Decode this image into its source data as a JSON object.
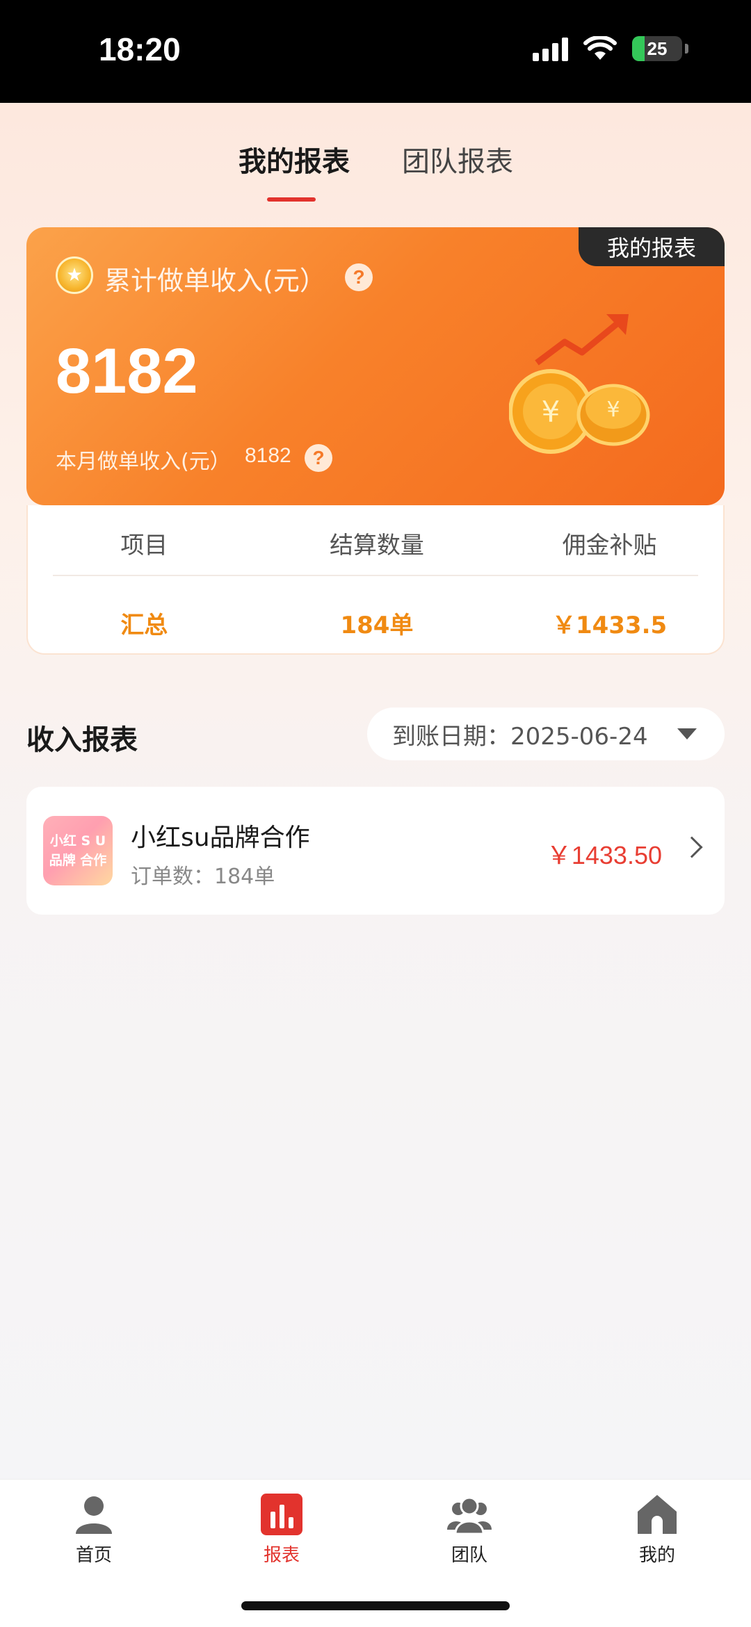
{
  "status_bar": {
    "time": "18:20",
    "battery": "25",
    "battery_level": 0.25
  },
  "tabs": [
    {
      "label": "我的报表",
      "active": true
    },
    {
      "label": "团队报表",
      "active": false
    }
  ],
  "income_card": {
    "corner_tag": "我的报表",
    "title": "累计做单收入(元）",
    "total": "8182",
    "month_label": "本月做单收入(元）",
    "month_value": "8182",
    "help_glyph": "?"
  },
  "summary": {
    "headers": [
      "项目",
      "结算数量",
      "佣金补贴"
    ],
    "row": [
      "汇总",
      "184单",
      "￥1433.5"
    ]
  },
  "income_report": {
    "title": "收入报表",
    "date_label": "到账日期：2025-06-24",
    "items": [
      {
        "logo_line1": "小红 S U",
        "logo_line2": "品牌 合作",
        "name": "小红su品牌合作",
        "orders": "订单数：184单",
        "amount": "￥1433.50"
      }
    ]
  },
  "bottom_nav": [
    {
      "label": "首页",
      "icon": "person-icon",
      "active": false
    },
    {
      "label": "报表",
      "icon": "report-chart-icon",
      "active": true
    },
    {
      "label": "团队",
      "icon": "team-icon",
      "active": false
    },
    {
      "label": "我的",
      "icon": "house-icon",
      "active": false
    }
  ],
  "colors": {
    "accent_red": "#e2332d",
    "card_orange": "#f8812a",
    "summary_orange": "#f08a12",
    "amount_red": "#e83e33"
  }
}
